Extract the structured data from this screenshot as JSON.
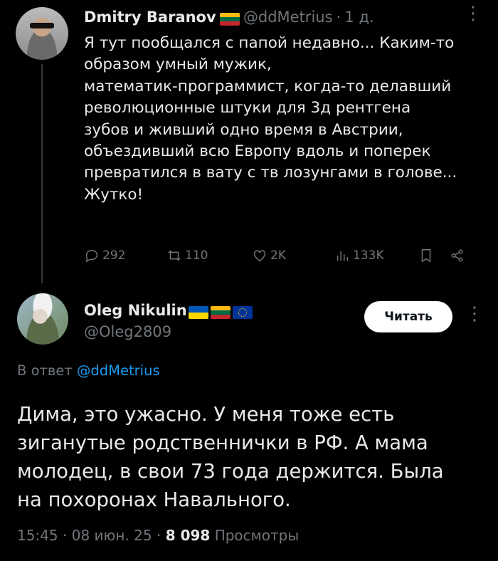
{
  "parent_tweet": {
    "author_name": "Dmitry Baranov",
    "handle": "@ddMetrius",
    "separator": "·",
    "time": "1 д.",
    "text": "Я тут пообщался с папой недавно... Каким-то\nобразом умный мужик,\nматематик-программист, когда-то делавший\nреволюционные штуки для 3д рентгена\nзубов и живший одно время в Австрии,\nобъездивший всю Европу вдоль и поперек\nпревратился в вату с тв лозунгами в голове...\nЖутко!",
    "actions": {
      "replies": "292",
      "reposts": "110",
      "likes": "2K",
      "views": "133K"
    }
  },
  "main_tweet": {
    "author_name": "Oleg Nikulin",
    "handle": "@Oleg2809",
    "follow_label": "Читать",
    "reply_prefix": "В ответ",
    "reply_handle": "@ddMetrius",
    "text": "Дима, это ужасно. У меня тоже есть\nзиганутые родственнички в РФ. А мама\nмолодец, в свои 73 года держится. Была\nна похоронах Навального.",
    "time": "15:45",
    "date": "08 июн. 25",
    "views_count": "8 098",
    "views_label": "Просмотры"
  },
  "colors": {
    "background": "#000000",
    "text": "#e7e9ea",
    "muted": "#71767b",
    "link": "#1d9bf0"
  }
}
